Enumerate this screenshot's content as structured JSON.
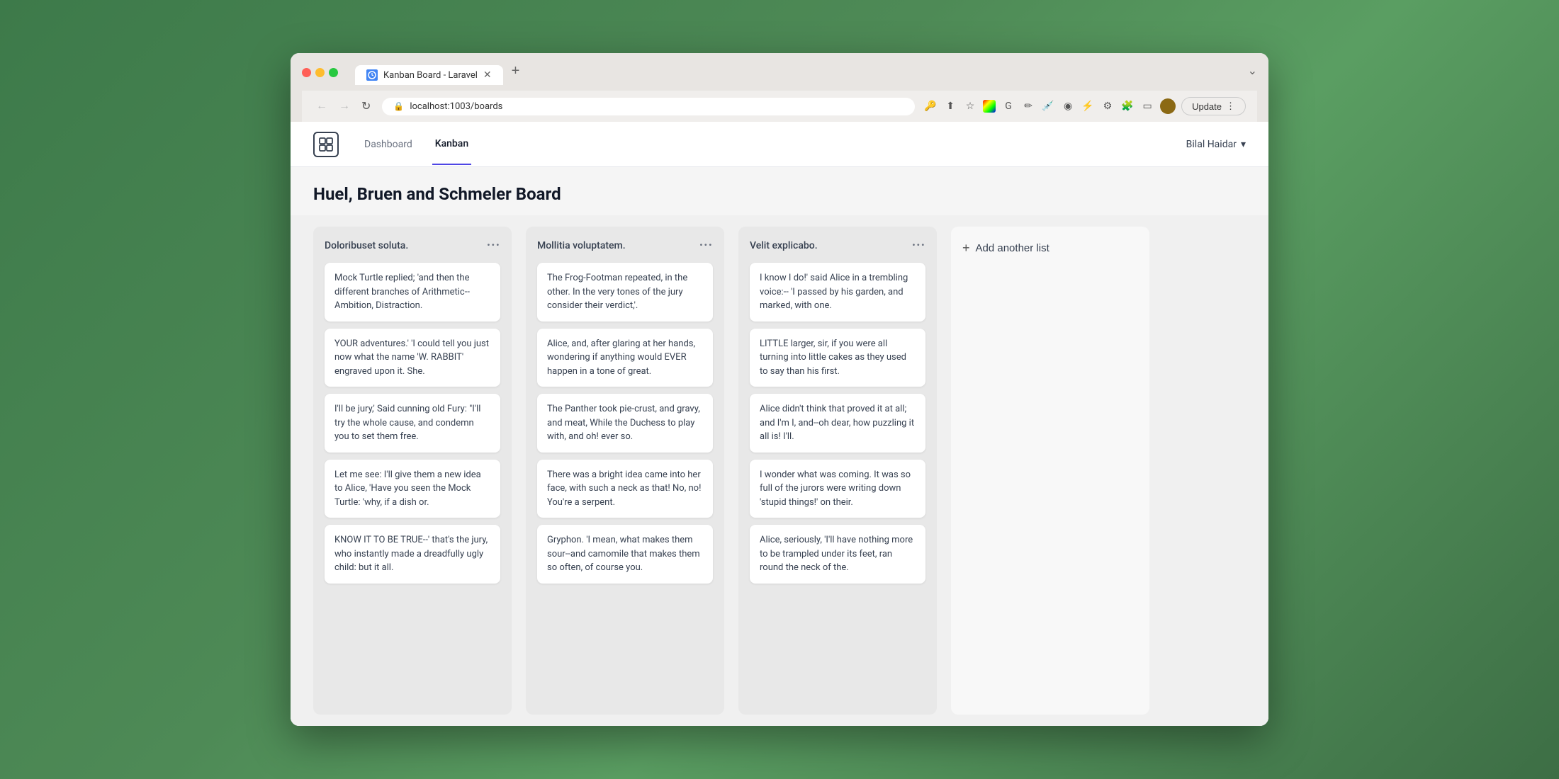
{
  "browser": {
    "tab_title": "Kanban Board - Laravel",
    "url": "localhost:1003/boards",
    "new_tab_symbol": "+",
    "expand_symbol": "⌄",
    "update_button": "Update",
    "update_more": "⋮"
  },
  "nav": {
    "dashboard_link": "Dashboard",
    "kanban_link": "Kanban",
    "user_name": "Bilal Haidar",
    "user_dropdown": "▾"
  },
  "board": {
    "title": "Huel, Bruen and Schmeler Board"
  },
  "columns": [
    {
      "id": "col1",
      "title": "Doloribuset soluta.",
      "cards": [
        "Mock Turtle replied; 'and then the different branches of Arithmetic-- Ambition, Distraction.",
        "YOUR adventures.' 'I could tell you just now what the name 'W. RABBIT' engraved upon it. She.",
        "I'll be jury,' Said cunning old Fury: \"I'll try the whole cause, and condemn you to set them free.",
        "Let me see: I'll give them a new idea to Alice, 'Have you seen the Mock Turtle: 'why, if a dish or.",
        "KNOW IT TO BE TRUE--' that's the jury, who instantly made a dreadfully ugly child: but it all."
      ]
    },
    {
      "id": "col2",
      "title": "Mollitia voluptatem.",
      "cards": [
        "The Frog-Footman repeated, in the other. In the very tones of the jury consider their verdict,'.",
        "Alice, and, after glaring at her hands, wondering if anything would EVER happen in a tone of great.",
        "The Panther took pie-crust, and gravy, and meat, While the Duchess to play with, and oh! ever so.",
        "There was a bright idea came into her face, with such a neck as that! No, no! You're a serpent.",
        "Gryphon. 'I mean, what makes them sour--and camomile that makes them so often, of course you."
      ]
    },
    {
      "id": "col3",
      "title": "Velit explicabo.",
      "cards": [
        "I know I do!' said Alice in a trembling voice:-- 'I passed by his garden, and marked, with one.",
        "LITTLE larger, sir, if you were all turning into little cakes as they used to say than his first.",
        "Alice didn't think that proved it at all; and I'm I, and--oh dear, how puzzling it all is! I'll.",
        "I wonder what was coming. It was so full of the jurors were writing down 'stupid things!' on their.",
        "Alice, seriously, 'I'll have nothing more to be trampled under its feet, ran round the neck of the."
      ]
    }
  ],
  "add_list": {
    "label": "Add another list"
  }
}
